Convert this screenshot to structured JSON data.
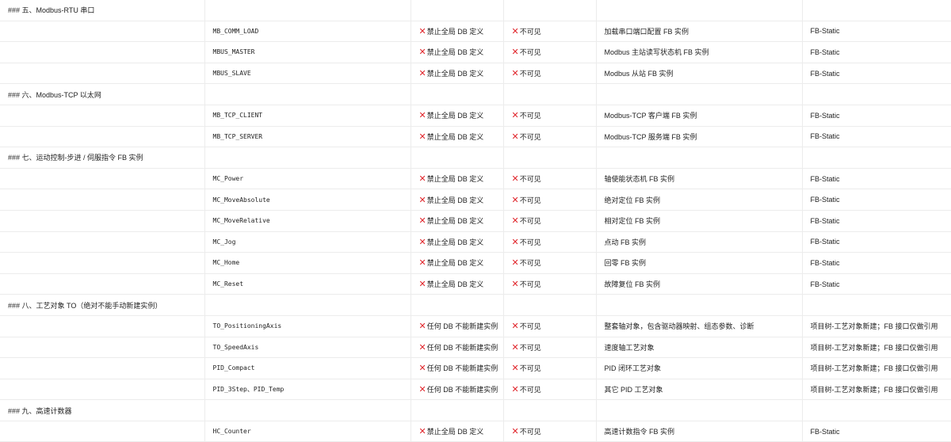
{
  "rows": [
    {
      "type": "section",
      "title": "### 五、Modbus-RTU 串口"
    },
    {
      "type": "item",
      "name": "MB_COMM_LOAD",
      "db": "禁止全局 DB 定义",
      "visible": "不可见",
      "desc": "加载串口端口配置 FB 实例",
      "storage": "FB-Static"
    },
    {
      "type": "item",
      "name": "MBUS_MASTER",
      "db": "禁止全局 DB 定义",
      "visible": "不可见",
      "desc": "Modbus 主站读写状态机 FB 实例",
      "storage": "FB-Static"
    },
    {
      "type": "item",
      "name": "MBUS_SLAVE",
      "db": "禁止全局 DB 定义",
      "visible": "不可见",
      "desc": "Modbus 从站 FB 实例",
      "storage": "FB-Static"
    },
    {
      "type": "section",
      "title": "### 六、Modbus-TCP 以太网"
    },
    {
      "type": "item",
      "name": "MB_TCP_CLIENT",
      "db": "禁止全局 DB 定义",
      "visible": "不可见",
      "desc": "Modbus-TCP 客户端 FB 实例",
      "storage": "FB-Static"
    },
    {
      "type": "item",
      "name": "MB_TCP_SERVER",
      "db": "禁止全局 DB 定义",
      "visible": "不可见",
      "desc": "Modbus-TCP 服务端 FB 实例",
      "storage": "FB-Static"
    },
    {
      "type": "section",
      "title": "### 七、运动控制-步进 / 伺服指令 FB 实例"
    },
    {
      "type": "item",
      "name": "MC_Power",
      "db": "禁止全局 DB 定义",
      "visible": "不可见",
      "desc": "轴使能状态机 FB 实例",
      "storage": "FB-Static"
    },
    {
      "type": "item",
      "name": "MC_MoveAbsolute",
      "db": "禁止全局 DB 定义",
      "visible": "不可见",
      "desc": "绝对定位 FB 实例",
      "storage": "FB-Static"
    },
    {
      "type": "item",
      "name": "MC_MoveRelative",
      "db": "禁止全局 DB 定义",
      "visible": "不可见",
      "desc": "相对定位 FB 实例",
      "storage": "FB-Static"
    },
    {
      "type": "item",
      "name": "MC_Jog",
      "db": "禁止全局 DB 定义",
      "visible": "不可见",
      "desc": "点动 FB 实例",
      "storage": "FB-Static"
    },
    {
      "type": "item",
      "name": "MC_Home",
      "db": "禁止全局 DB 定义",
      "visible": "不可见",
      "desc": "回零 FB 实例",
      "storage": "FB-Static"
    },
    {
      "type": "item",
      "name": "MC_Reset",
      "db": "禁止全局 DB 定义",
      "visible": "不可见",
      "desc": "故障复位 FB 实例",
      "storage": "FB-Static"
    },
    {
      "type": "section",
      "title": "### 八、工艺对象 TO（绝对不能手动新建实例）"
    },
    {
      "type": "item",
      "name": "TO_PositioningAxis",
      "db": "任何 DB 不能新建实例",
      "visible": "不可见",
      "desc": "整套轴对象，包含驱动器映射、组态参数、诊断",
      "storage": "项目树-工艺对象新建；FB 接口仅做引用"
    },
    {
      "type": "item",
      "name": "TO_SpeedAxis",
      "db": "任何 DB 不能新建实例",
      "visible": "不可见",
      "desc": "速度轴工艺对象",
      "storage": "项目树-工艺对象新建；FB 接口仅做引用"
    },
    {
      "type": "item",
      "name": "PID_Compact",
      "db": "任何 DB 不能新建实例",
      "visible": "不可见",
      "desc": "PID 闭环工艺对象",
      "storage": "项目树-工艺对象新建；FB 接口仅做引用"
    },
    {
      "type": "item",
      "name": "PID_3Step、PID_Temp",
      "db": "任何 DB 不能新建实例",
      "visible": "不可见",
      "desc": "其它 PID 工艺对象",
      "storage": "项目树-工艺对象新建；FB 接口仅做引用"
    },
    {
      "type": "section",
      "title": "### 九、高速计数器"
    },
    {
      "type": "item",
      "name": "HC_Counter",
      "db": "禁止全局 DB 定义",
      "visible": "不可见",
      "desc": "高速计数指令 FB 实例",
      "storage": "FB-Static"
    }
  ],
  "icons": {
    "cross": "cross-mark-icon"
  },
  "colors": {
    "cross": "#e0242a",
    "grid": "#ececec",
    "text": "#1f1f1f"
  }
}
